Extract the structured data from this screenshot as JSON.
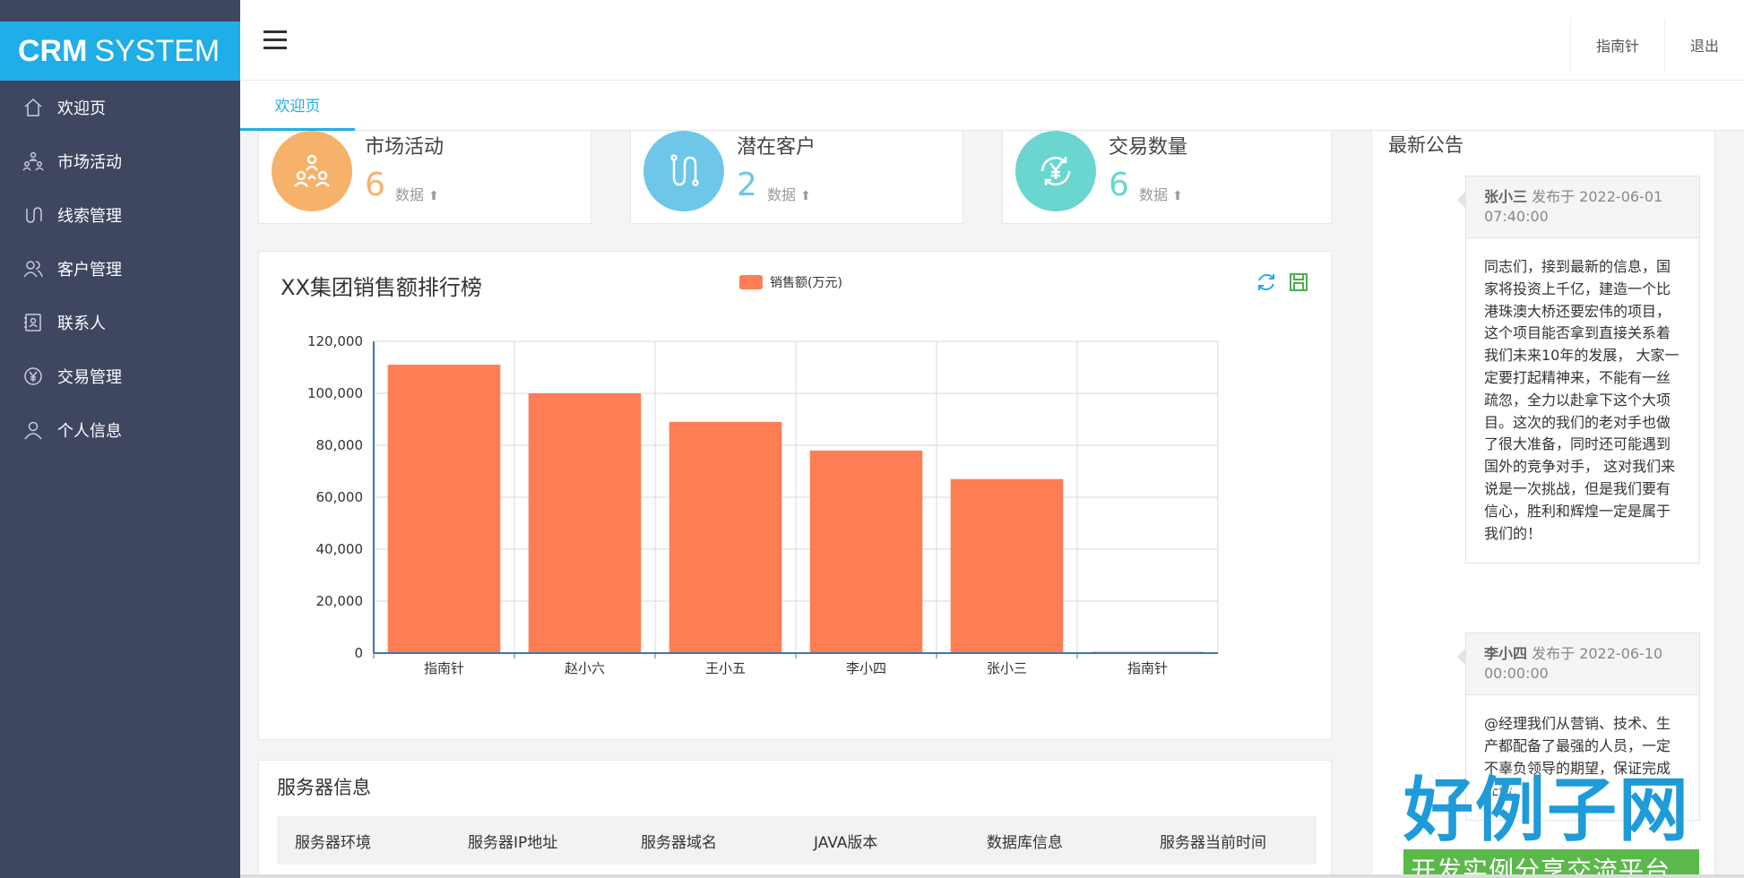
{
  "logo": {
    "bold": "CRM",
    "rest": "SYSTEM"
  },
  "sidebar": {
    "items": [
      {
        "label": "欢迎页",
        "icon": "home-icon"
      },
      {
        "label": "市场活动",
        "icon": "people-icon"
      },
      {
        "label": "线索管理",
        "icon": "route-icon"
      },
      {
        "label": "客户管理",
        "icon": "user-group-icon"
      },
      {
        "label": "联系人",
        "icon": "contact-card-icon"
      },
      {
        "label": "交易管理",
        "icon": "yen-icon"
      },
      {
        "label": "个人信息",
        "icon": "user-icon"
      }
    ]
  },
  "header": {
    "user": "指南针",
    "logout": "退出"
  },
  "tabs": [
    {
      "label": "欢迎页"
    }
  ],
  "stats": [
    {
      "title": "市场活动",
      "value": "6",
      "unit": "数据",
      "color": "#f6b26b"
    },
    {
      "title": "潜在客户",
      "value": "2",
      "unit": "数据",
      "color": "#6ec6e8"
    },
    {
      "title": "交易数量",
      "value": "6",
      "unit": "数据",
      "color": "#6ad6cf"
    }
  ],
  "chart_data": {
    "type": "bar",
    "title": "XX集团销售额排行榜",
    "categories": [
      "指南针",
      "赵小六",
      "王小五",
      "李小四",
      "张小三",
      "指南针"
    ],
    "series": [
      {
        "name": "销售额(万元)",
        "values": [
          111000,
          100000,
          89000,
          78000,
          67000,
          500
        ]
      }
    ],
    "ylim": [
      0,
      120000
    ],
    "yticks": [
      "0",
      "20,000",
      "40,000",
      "60,000",
      "80,000",
      "100,000",
      "120,000"
    ],
    "grid": true,
    "legend": "top-center",
    "color": "#fd7e55"
  },
  "server": {
    "title": "服务器信息",
    "columns": [
      "服务器环境",
      "服务器IP地址",
      "服务器域名",
      "JAVA版本",
      "数据库信息",
      "服务器当前时间"
    ]
  },
  "notices": {
    "title": "最新公告",
    "items": [
      {
        "author": "张小三",
        "posted": "发布于 2022-06-01 07:40:00",
        "body": "同志们，接到最新的信息，国家将投资上千亿，建造一个比港珠澳大桥还要宏伟的项目，这个项目能否拿到直接关系着我们未来10年的发展， 大家一定要打起精神来，不能有一丝疏忽，全力以赴拿下这个大项目。这次的我们的老对手也做了很大准备，同时还可能遇到国外的竞争对手， 这对我们来说是一次挑战，但是我们要有信心，胜利和辉煌一定是属于我们的！"
      },
      {
        "author": "李小四",
        "posted": "发布于 2022-06-10 00:00:00",
        "body": "@经理我们从营销、技术、生产都配备了最强的人员，一定不辜负领导的期望，保证完成任务"
      }
    ]
  },
  "watermark": {
    "big": "好例子网",
    "small": "开发实例分享交流平台"
  }
}
